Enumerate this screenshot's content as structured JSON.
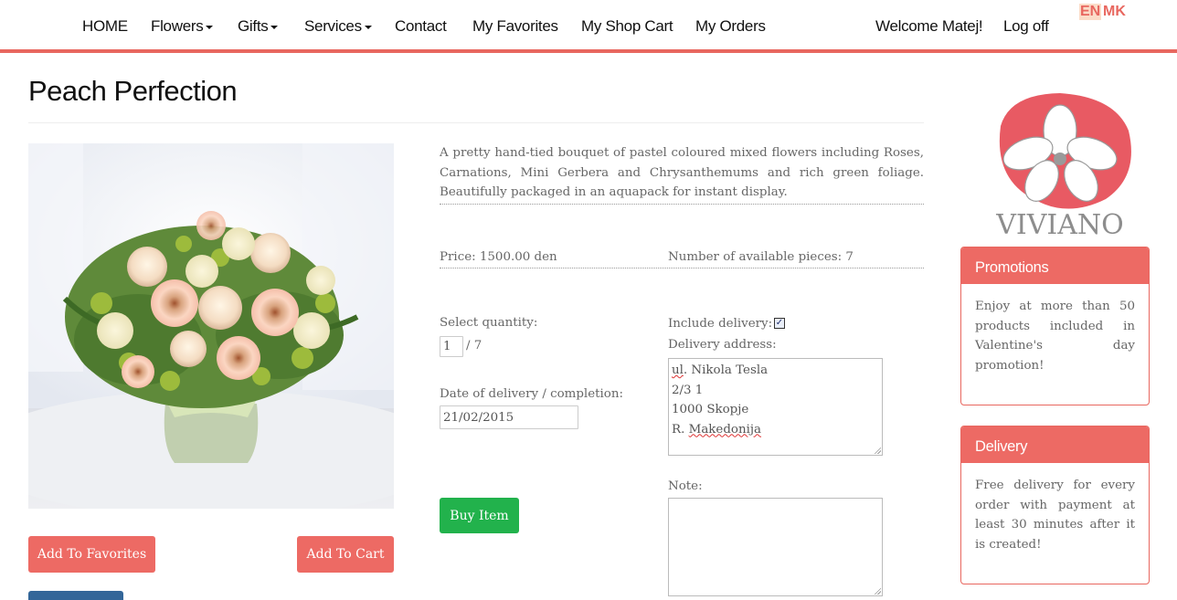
{
  "nav": {
    "home": "HOME",
    "flowers": "Flowers",
    "gifts": "Gifts",
    "services": "Services",
    "contact": "Contact",
    "favorites": "My Favorites",
    "cart": "My Shop Cart",
    "orders": "My Orders",
    "welcome": "Welcome Matej!",
    "logoff": "Log off",
    "lang_en": "EN",
    "lang_mk": "MK"
  },
  "product": {
    "title": "Peach Perfection",
    "description": "A pretty hand-tied bouquet of pastel coloured mixed flowers including Roses, Carnations, Mini Gerbera and Chrysanthemums and rich green foliage. Beautifully packaged in an aquapack for instant display.",
    "price": "Price: 1500.00 den",
    "available": "Number of available pieces: 7"
  },
  "order_form": {
    "quantity_label": "Select quantity:",
    "quantity_value": "1",
    "quantity_max": "/ 7",
    "date_label": "Date of delivery / completion:",
    "date_value": "21/02/2015",
    "include_delivery_label": "Include delivery:",
    "include_delivery_checked": true,
    "address_label": "Delivery address:",
    "address_lines": [
      "ul. Nikola Tesla",
      "2/3 1",
      "1000 Skopje",
      "R. Makedonija"
    ],
    "note_label": "Note:",
    "note_value": ""
  },
  "buttons": {
    "add_favorites": "Add To Favorites",
    "add_cart": "Add To Cart",
    "buy": "Buy Item"
  },
  "sidebar": {
    "logo_text": "VIVIANO",
    "promotions": {
      "title": "Promotions",
      "body": "Enjoy at more than 50 products included in Valentine's day promotion!"
    },
    "delivery": {
      "title": "Delivery",
      "body": "Free delivery for every order with payment at least 30 minutes after it is created!"
    }
  },
  "colors": {
    "accent": "#ed6a64",
    "buy_button": "#22b24c",
    "secondary_button": "#336699"
  }
}
